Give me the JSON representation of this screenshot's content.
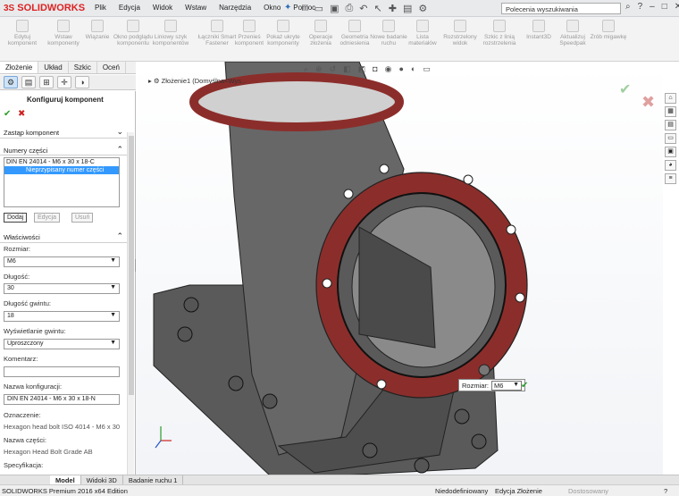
{
  "app": {
    "logo": "SOLIDWORKS",
    "logo_mark": "3S"
  },
  "menu": [
    "Plik",
    "Edycja",
    "Widok",
    "Wstaw",
    "Narzędzia",
    "Okno",
    "Pomoc"
  ],
  "search": {
    "placeholder": "Polecenia wyszukiwania"
  },
  "ribbon": [
    "Edytuj komponent",
    "Wstaw komponenty",
    "Wiązanie",
    "Okno podglądu komponentu",
    "Liniowy szyk komponentów",
    "Łączniki Smart Fastener",
    "Przenieś komponent",
    "Pokaż ukryte komponenty",
    "Operacje złożenia",
    "Geometria odniesienia",
    "Nowe badanie ruchu",
    "Lista materiałów",
    "Rozstrzelony widok",
    "Szkic z linią rozstrzelenia",
    "Instant3D",
    "Aktualizuj Speedpak",
    "Zrób migawkę"
  ],
  "tabs": [
    "Złożenie",
    "Układ",
    "Szkic",
    "Oceń"
  ],
  "panel": {
    "title": "Konfiguruj komponent",
    "replace_section": "Zastąp komponent",
    "part_numbers_section": "Numery części",
    "part_list": [
      "DIN EN 24014 - M6 x 30 x 18-C",
      "Nieprzypisany numer części"
    ],
    "buttons": {
      "add": "Dodaj",
      "edit": "Edycja",
      "delete": "Usuń"
    },
    "properties_section": "Właściwości",
    "size_label": "Rozmiar:",
    "size_value": "M6",
    "length_label": "Długość:",
    "length_value": "30",
    "thread_label": "Długość gwintu:",
    "thread_value": "18",
    "thread_display_label": "Wyświetlanie gwintu:",
    "thread_display_value": "Uproszczony",
    "comment_label": "Komentarz:",
    "comment_value": "",
    "config_name_label": "Nazwa konfiguracji:",
    "config_name_value": "DIN EN 24014 - M6 x 30 x 18-N",
    "designation_label": "Oznaczenie:",
    "designation_value": "Hexagon head bolt ISO 4014 - M6 x 30",
    "part_name_label": "Nazwa części:",
    "part_name_value": "Hexagon Head Bolt Grade AB",
    "spec_label": "Specyfikacja:"
  },
  "viewport": {
    "tree_label": "Złożenie1 (Domyślna<Wys...",
    "callout_label": "Rozmiar:",
    "callout_value": "M6"
  },
  "bottom_tabs": [
    "Model",
    "Widoki 3D",
    "Badanie ruchu 1"
  ],
  "status": {
    "edition": "SOLIDWORKS Premium 2016 x64 Edition",
    "state": "Niedodefiniowany",
    "mode": "Edycja Złożenie",
    "custom": "Dostosowany"
  },
  "colors": {
    "flange": "#8b2e2b",
    "body": "#6b6b6b",
    "selection": "#3399ff",
    "accept": "#2a9d2a",
    "cancel": "#cc2222"
  }
}
